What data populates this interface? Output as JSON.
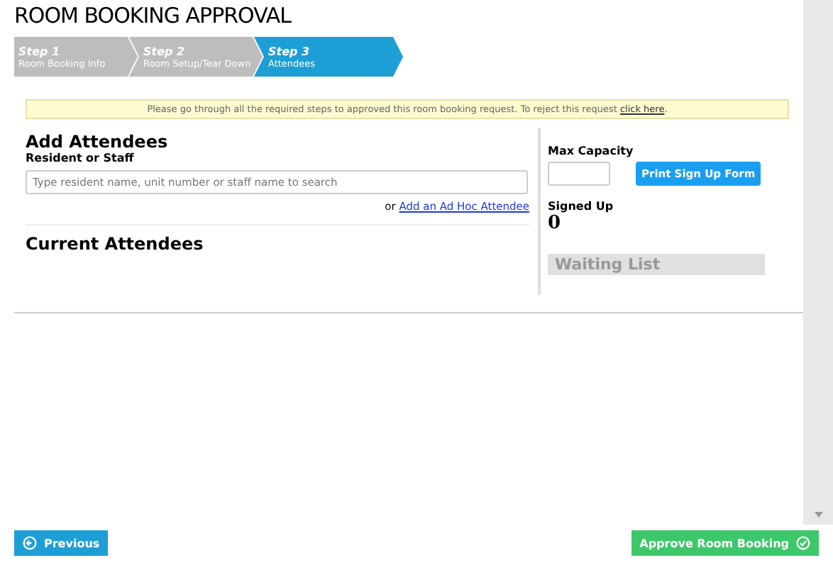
{
  "title": "ROOM BOOKING APPROVAL",
  "steps": [
    {
      "step": "Step 1",
      "label": "Room Booking Info",
      "selected": false
    },
    {
      "step": "Step 2",
      "label": "Room Setup/Tear Down",
      "selected": false
    },
    {
      "step": "Step 3",
      "label": "Attendees",
      "selected": true
    }
  ],
  "notice": {
    "text": "Please go through all the required steps to approved this room booking request. To reject this request",
    "link": "click here",
    "end": "."
  },
  "add_attendees": {
    "heading": "Add Attendees",
    "field_label": "Resident or Staff",
    "placeholder": "Type resident name, unit number or staff name to search",
    "or_text": "or",
    "link": "Add an Ad Hoc Attendee"
  },
  "current_attendees": {
    "heading": "Current Attendees"
  },
  "side": {
    "max_capacity_label": "Max Capacity",
    "print_button": "Print Sign Up Form",
    "signed_up_label": "Signed Up",
    "signed_up_value": "0",
    "waiting_list": "Waiting List"
  },
  "footer": {
    "previous": "Previous",
    "approve": "Approve Room Booking"
  }
}
